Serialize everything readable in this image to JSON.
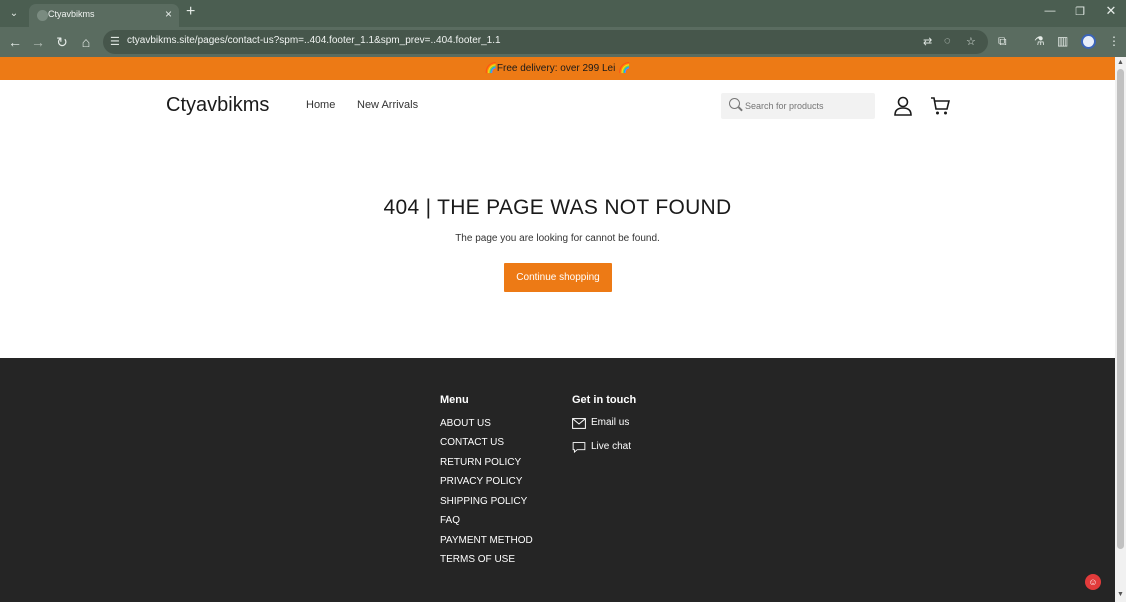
{
  "browser": {
    "tab_title": "Ctyavbikms",
    "url": "ctyavbikms.site/pages/contact-us?spm=..404.footer_1.1&spm_prev=..404.footer_1.1"
  },
  "promo": {
    "text": "🌈Free delivery: over 299 Lei 🌈"
  },
  "header": {
    "logo": "Ctyavbikms",
    "nav": [
      "Home",
      "New Arrivals"
    ],
    "search_placeholder": "Search for products"
  },
  "notfound": {
    "title": "404 | THE PAGE WAS NOT FOUND",
    "subtitle": "The page you are looking for cannot be found.",
    "button": "Continue shopping"
  },
  "footer": {
    "menu_title": "Menu",
    "menu_items": [
      "ABOUT US",
      "CONTACT US",
      "RETURN POLICY",
      "PRIVACY POLICY",
      "SHIPPING POLICY",
      "FAQ",
      "PAYMENT METHOD",
      "TERMS OF USE"
    ],
    "contact_title": "Get in touch",
    "contact_items": [
      "Email us",
      "Live chat"
    ]
  },
  "colors": {
    "accent": "#ed7a15",
    "footer_bg": "#252525",
    "chrome": "#5a6c60"
  }
}
